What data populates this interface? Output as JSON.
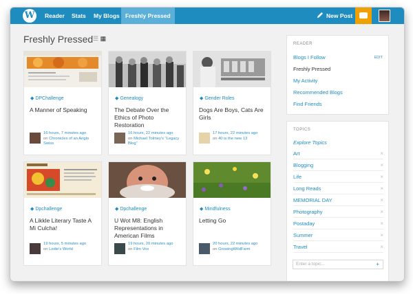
{
  "nav": {
    "logo": "W",
    "reader": "Reader",
    "stats": "Stats",
    "my_blogs": "My Blogs",
    "freshly_pressed": "Freshly Pressed",
    "new_post": "New Post"
  },
  "page": {
    "title": "Freshly Pressed"
  },
  "cards": [
    {
      "tag": "DPChallenge",
      "title": "A Manner of Speaking",
      "time": "16 hours, 7 minutes ago",
      "on": "on",
      "blog": "Chronicles of an Anglo Swiss"
    },
    {
      "tag": "Genealogy",
      "title": "The Debate Over the Ethics of Photo Restoration",
      "time": "16 hours, 22 minutes ago",
      "on": "on",
      "blog": "Michael Tolmey's \"Legacy Blog\""
    },
    {
      "tag": "Gender Roles",
      "title": "Dogs Are Boys, Cats Are Girls",
      "time": "17 hours, 22 minutes ago",
      "on": "on",
      "blog": "40 is the new 13"
    },
    {
      "tag": "Dpchallenge",
      "title": "A Likkle Literary Taste A Mi Culcha!",
      "time": "19 hours, 5 minutes ago",
      "on": "on",
      "blog": "Lodie's World"
    },
    {
      "tag": "Dpchallenge",
      "title": "U Wot M8: English Representations in American Films",
      "time": "19 hours, 20 minutes ago",
      "on": "on",
      "blog": "Film Vox"
    },
    {
      "tag": "Mindfulness",
      "title": "Letting Go",
      "time": "20 hours, 22 minutes ago",
      "on": "on",
      "blog": "GrowingWildFarm"
    }
  ],
  "reader_panel": {
    "heading": "READER",
    "edit": "EDIT",
    "links": [
      "Blogs I Follow",
      "Freshly Pressed",
      "My Activity",
      "Recommended Blogs",
      "Find Friends"
    ]
  },
  "topics_panel": {
    "heading": "TOPICS",
    "explore": "Explore Topics",
    "topics": [
      "Art",
      "Blogging",
      "Life",
      "Long Reads",
      "MEMORIAL DAY",
      "Photography",
      "Postaday",
      "Summer",
      "Travel"
    ],
    "remove_icon": "×",
    "input_placeholder": "Enter a topic...",
    "add_icon": "+"
  },
  "colors": {
    "accent": "#1e8cbe",
    "notify": "#f0a000"
  }
}
